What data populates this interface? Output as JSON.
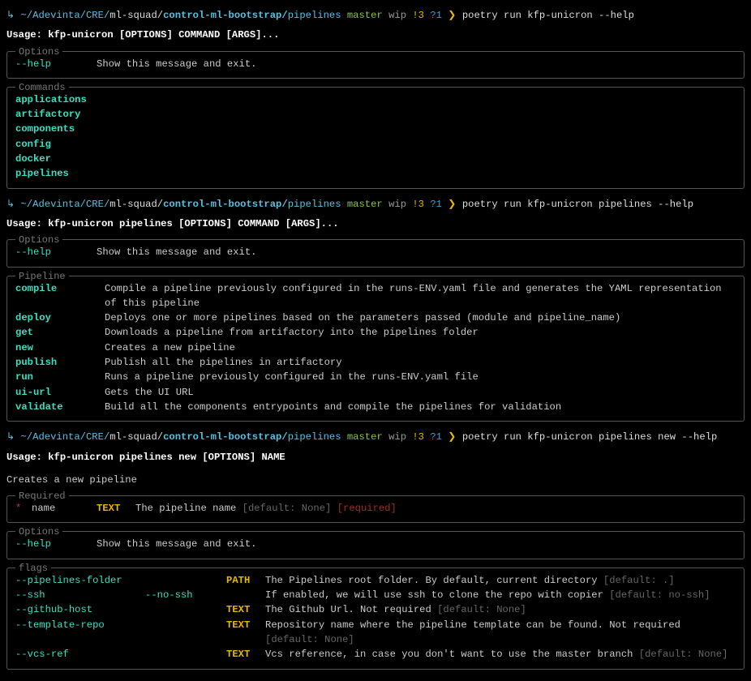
{
  "prompt": {
    "apple": "",
    "arrow": "↳",
    "path_home": "~/Adevinta/CRE/",
    "path_mid": "ml-squad/",
    "path_repo": "control-ml-bootstrap/",
    "path_leaf": "pipelines",
    "git_sym": " ",
    "branch": "master",
    "wip": "wip",
    "ex": "!3",
    "qm": "?1",
    "rangle": "❯"
  },
  "block1": {
    "command": "poetry run kfp-unicron --help",
    "usage_prefix": "Usage: ",
    "usage": "kfp-unicron [OPTIONS] COMMAND [ARGS]...",
    "options_legend": "Options",
    "options": [
      {
        "name": "--help",
        "desc": "Show this message and exit."
      }
    ],
    "commands_legend": "Commands",
    "commands": [
      "applications",
      "artifactory",
      "components",
      "config",
      "docker",
      "pipelines"
    ]
  },
  "block2": {
    "command": "poetry run kfp-unicron pipelines --help",
    "usage_prefix": "Usage: ",
    "usage": "kfp-unicron pipelines [OPTIONS] COMMAND [ARGS]...",
    "options_legend": "Options",
    "options": [
      {
        "name": "--help",
        "desc": "Show this message and exit."
      }
    ],
    "pipeline_legend": "Pipeline",
    "pipeline": [
      {
        "name": "compile",
        "desc": "Compile a pipeline previously configured in the runs-ENV.yaml file and generates the YAML representation of this pipeline"
      },
      {
        "name": "deploy",
        "desc": "Deploys one or more pipelines based on the parameters passed (module and pipeline_name)"
      },
      {
        "name": "get",
        "desc": "Downloads a pipeline from artifactory into the pipelines folder"
      },
      {
        "name": "new",
        "desc": "Creates a new pipeline"
      },
      {
        "name": "publish",
        "desc": "Publish all the pipelines in artifactory"
      },
      {
        "name": "run",
        "desc": "Runs a pipeline previously configured in the runs-ENV.yaml file"
      },
      {
        "name": "ui-url",
        "desc": "Gets the UI URL"
      },
      {
        "name": "validate",
        "desc": "Build all the components entrypoints and compile the pipelines for validation"
      }
    ]
  },
  "block3": {
    "command": "poetry run kfp-unicron pipelines new --help",
    "usage_prefix": "Usage: ",
    "usage": "kfp-unicron pipelines new [OPTIONS] NAME",
    "description": "Creates a new pipeline",
    "required_legend": "Required",
    "required": {
      "star": "*",
      "name": "name",
      "type": "TEXT",
      "desc": "The pipeline name ",
      "default": "[default: None]",
      "required_tag": "[required]"
    },
    "options_legend": "Options",
    "options": [
      {
        "name": "--help",
        "desc": "Show this message and exit."
      }
    ],
    "flags_legend": "flags",
    "flags": [
      {
        "name": "--pipelines-folder",
        "alt": "",
        "type": "PATH",
        "desc": "The Pipelines root folder. By default, current directory ",
        "default": "[default: .]"
      },
      {
        "name": "--ssh",
        "alt": "--no-ssh",
        "type": "",
        "desc": "If enabled, we will use ssh to clone the repo with copier ",
        "default": "[default: no-ssh]"
      },
      {
        "name": "--github-host",
        "alt": "",
        "type": "TEXT",
        "desc": "The Github Url. Not required ",
        "default": "[default: None]"
      },
      {
        "name": "--template-repo",
        "alt": "",
        "type": "TEXT",
        "desc": "Repository name where the pipeline template can be found. Not required ",
        "default": "[default: None]"
      },
      {
        "name": "--vcs-ref",
        "alt": "",
        "type": "TEXT",
        "desc": "Vcs reference, in case you don't want to use the master branch ",
        "default": "[default: None]"
      }
    ]
  }
}
